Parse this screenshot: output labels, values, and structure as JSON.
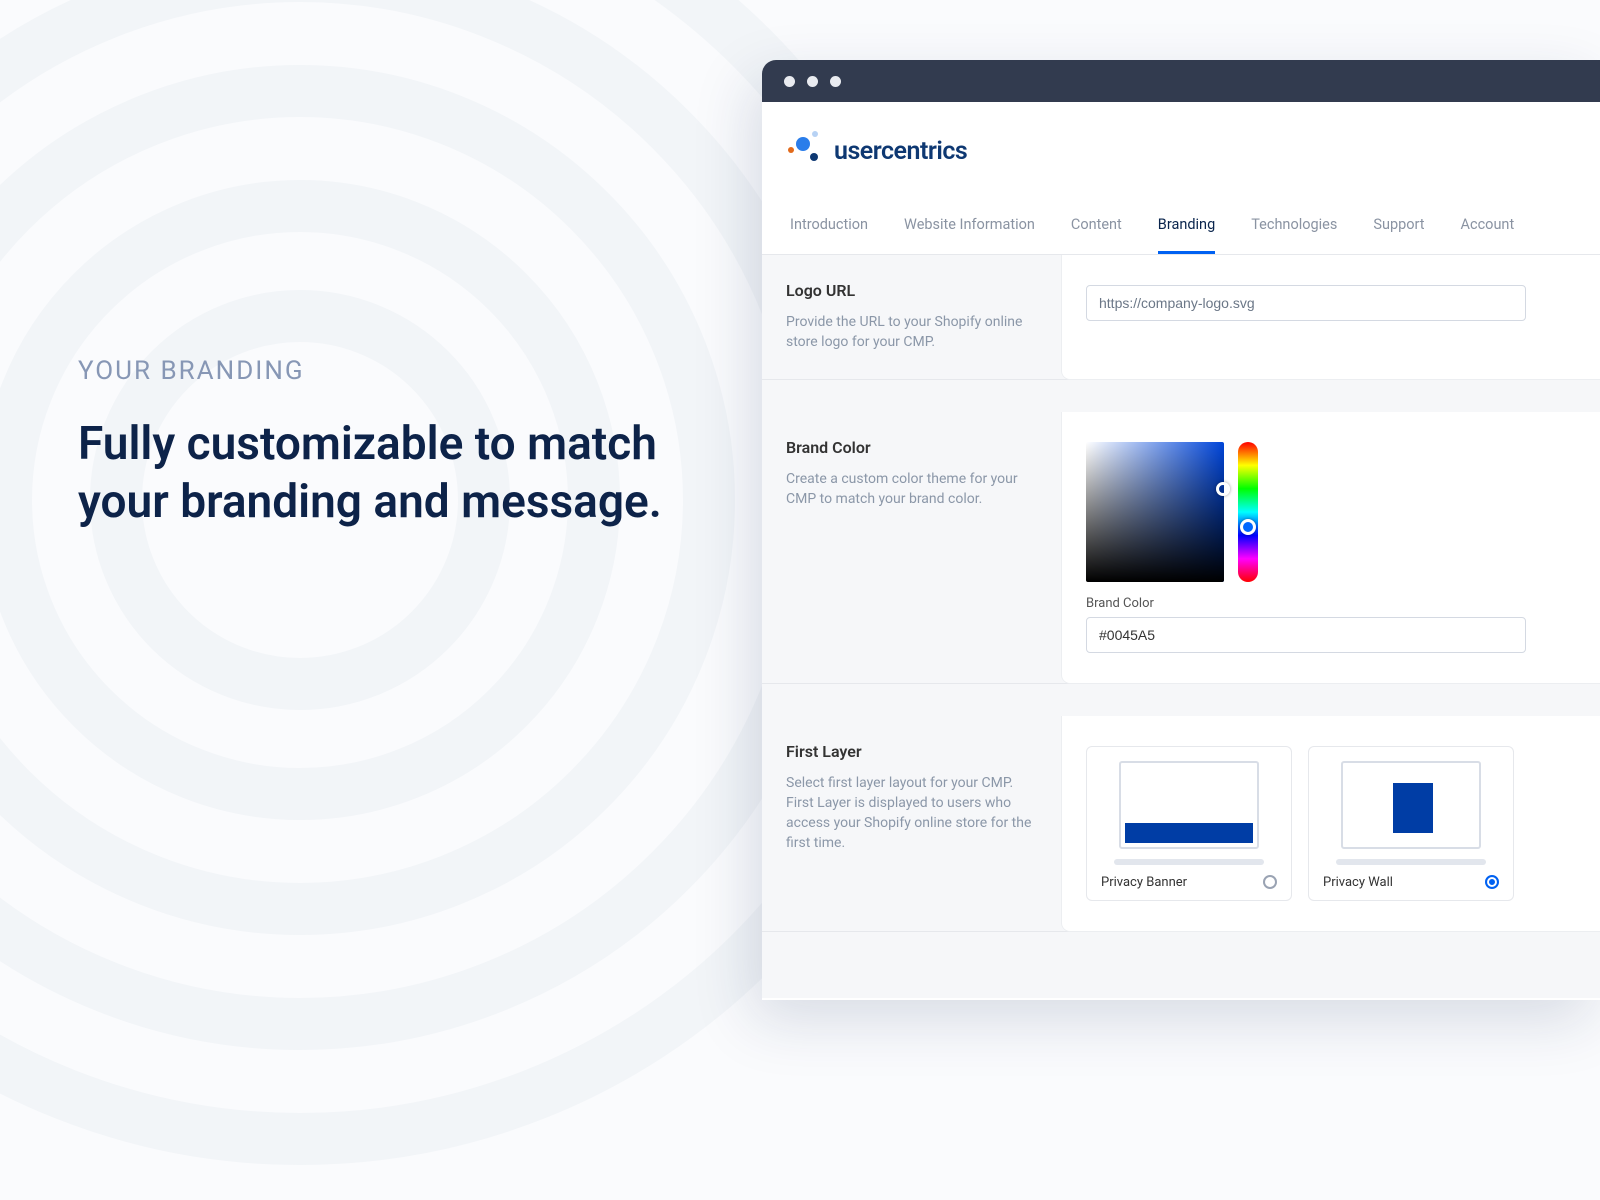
{
  "marketing": {
    "eyebrow": "YOUR BRANDING",
    "headline": "Fully customizable to match your branding and message."
  },
  "app": {
    "logo_text": "usercentrics"
  },
  "tabs": [
    {
      "label": "Introduction",
      "active": false
    },
    {
      "label": "Website Information",
      "active": false
    },
    {
      "label": "Content",
      "active": false
    },
    {
      "label": "Branding",
      "active": true
    },
    {
      "label": "Technologies",
      "active": false
    },
    {
      "label": "Support",
      "active": false
    },
    {
      "label": "Account",
      "active": false
    }
  ],
  "sections": {
    "logo_url": {
      "title": "Logo URL",
      "description": "Provide the URL to your Shopify online store logo for your CMP.",
      "placeholder": "https://company-logo.svg",
      "value": ""
    },
    "brand_color": {
      "title": "Brand Color",
      "description": "Create a custom color theme for your CMP to match your brand color.",
      "field_label": "Brand Color",
      "value": "#0045A5"
    },
    "first_layer": {
      "title": "First Layer",
      "description": "Select first layer layout for your CMP. First Layer is displayed to users who access your Shopify online store for the first time.",
      "options": [
        {
          "label": "Privacy Banner",
          "checked": false
        },
        {
          "label": "Privacy Wall",
          "checked": true
        }
      ]
    }
  }
}
